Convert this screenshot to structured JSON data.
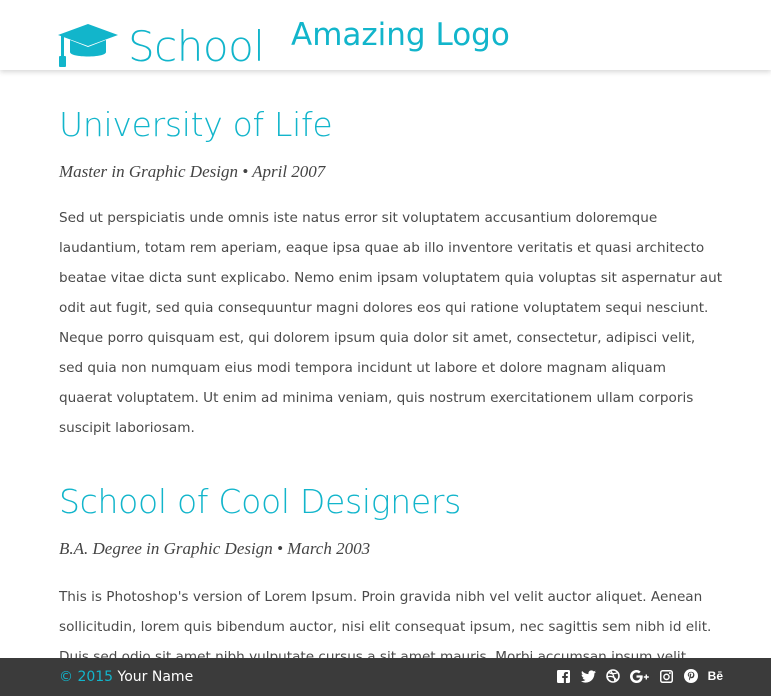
{
  "header": {
    "section_title": "School",
    "brand_logo": "Amazing Logo"
  },
  "entries": [
    {
      "title": "University of Life",
      "meta": "Master in Graphic Design • April 2007",
      "text": "Sed ut perspiciatis unde omnis iste natus error sit voluptatem accusantium doloremque laudantium, totam rem aperiam, eaque ipsa quae ab illo inventore veritatis et quasi architecto beatae vitae dicta sunt explicabo. Nemo enim ipsam voluptatem quia voluptas sit aspernatur aut odit aut fugit, sed quia consequuntur magni dolores eos qui ratione voluptatem sequi nesciunt. Neque porro quisquam est, qui dolorem ipsum quia dolor sit amet, consectetur, adipisci velit, sed quia non numquam eius modi tempora incidunt ut labore et dolore magnam aliquam quaerat voluptatem. Ut enim ad minima veniam, quis nostrum exercitationem ullam corporis suscipit laboriosam."
    },
    {
      "title": "School of Cool Designers",
      "meta": "B.A. Degree in Graphic Design • March 2003",
      "text": "This is Photoshop's version of Lorem Ipsum. Proin gravida nibh vel velit auctor aliquet. Aenean sollicitudin, lorem quis bibendum auctor, nisi elit consequat ipsum, nec sagittis sem nibh id elit. Duis sed odio sit amet nibh vulputate cursus a sit amet mauris. Morbi accumsan ipsum velit. Nam nec tellus a odio tincidunt auctor a ornare odio."
    }
  ],
  "footer": {
    "copyright_symbol_year": "© 2015",
    "author": "Your Name",
    "social": [
      {
        "icon": "facebook-icon",
        "glyph": "f"
      },
      {
        "icon": "twitter-icon",
        "glyph": ""
      },
      {
        "icon": "dribbble-icon",
        "glyph": ""
      },
      {
        "icon": "google-plus-icon",
        "glyph": "G+"
      },
      {
        "icon": "instagram-icon",
        "glyph": ""
      },
      {
        "icon": "pinterest-icon",
        "glyph": ""
      },
      {
        "icon": "behance-icon",
        "glyph": "Bē"
      }
    ]
  },
  "colors": {
    "accent": "#12b5cb",
    "footer_bg": "#3b3b3b",
    "body_text": "#4a4a4a"
  }
}
